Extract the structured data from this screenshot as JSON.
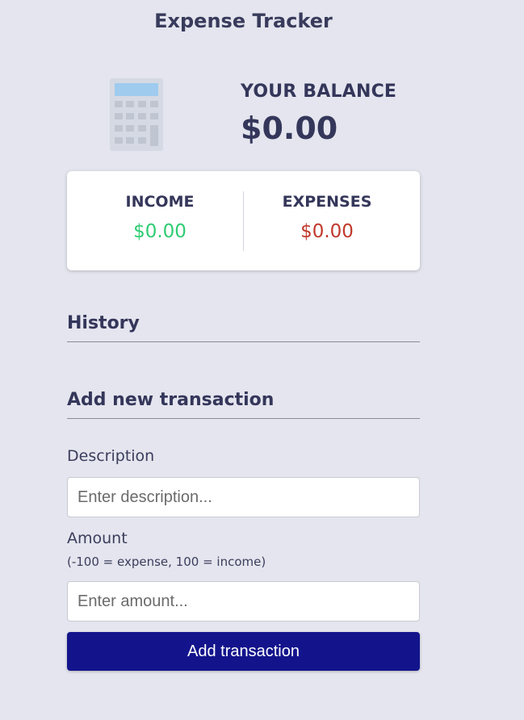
{
  "app": {
    "title": "Expense Tracker"
  },
  "balance": {
    "label": "YOUR BALANCE",
    "amount": "$0.00",
    "icon": "calculator-icon"
  },
  "summary": {
    "income_label": "INCOME",
    "income_value": "$0.00",
    "expenses_label": "EXPENSES",
    "expenses_value": "$0.00"
  },
  "history": {
    "heading": "History"
  },
  "form": {
    "heading": "Add new transaction",
    "description_label": "Description",
    "description_value": "",
    "description_placeholder": "Enter description...",
    "amount_label": "Amount",
    "amount_hint": "(-100 = expense, 100 = income)",
    "amount_value": "",
    "amount_placeholder": "Enter amount...",
    "submit_label": "Add transaction"
  },
  "colors": {
    "background": "#e4e5ee",
    "income": "#2ecc71",
    "expense": "#c0392b",
    "button": "#13148c",
    "text": "#34365a"
  }
}
